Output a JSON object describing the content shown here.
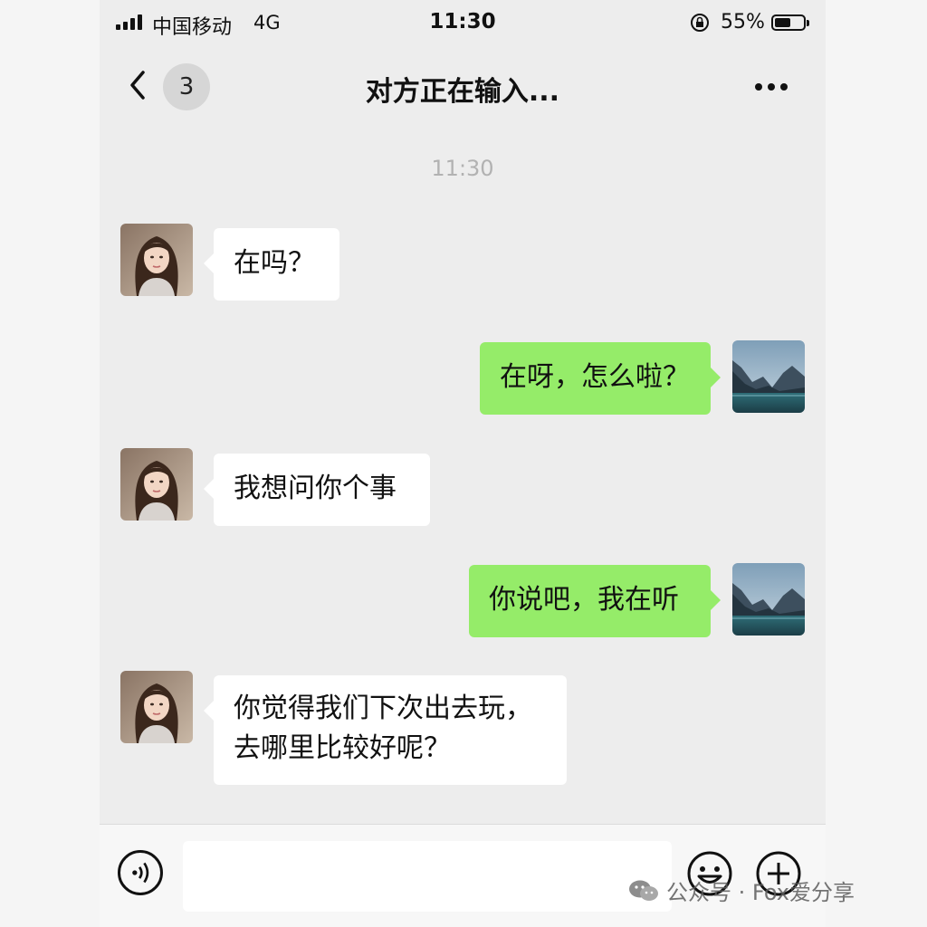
{
  "status_bar": {
    "carrier": "中国移动",
    "network": "4G",
    "time": "11:30",
    "battery": "55%",
    "battery_level": 0.55
  },
  "nav": {
    "back_icon": "chevron-left-icon",
    "unread_count": "3",
    "title": "对方正在输入...",
    "more_icon": "more-dots-icon"
  },
  "chat": {
    "timestamp": "11:30",
    "messages": [
      {
        "from": "contact",
        "avatar": "woman-portrait",
        "text": "在吗？"
      },
      {
        "from": "me",
        "avatar": "mountain-lake",
        "text": "在呀，怎么啦？"
      },
      {
        "from": "contact",
        "avatar": "woman-portrait",
        "text": "我想问你个事"
      },
      {
        "from": "me",
        "avatar": "mountain-lake",
        "text": "你说吧，我在听"
      },
      {
        "from": "contact",
        "avatar": "woman-portrait",
        "lines": [
          "你觉得我们下次出去玩，",
          "去哪里比较好呢？"
        ]
      }
    ]
  },
  "input_bar": {
    "voice_icon": "voice-icon",
    "input_value": "",
    "emoji_icon": "emoji-icon",
    "plus_icon": "plus-circle-icon"
  },
  "watermark": {
    "text": "公众号 · Fox爱分享",
    "icon": "wechat-icon"
  },
  "colors": {
    "background": "#ededed",
    "outgoing_bubble": "#95ec69",
    "incoming_bubble": "#ffffff"
  }
}
